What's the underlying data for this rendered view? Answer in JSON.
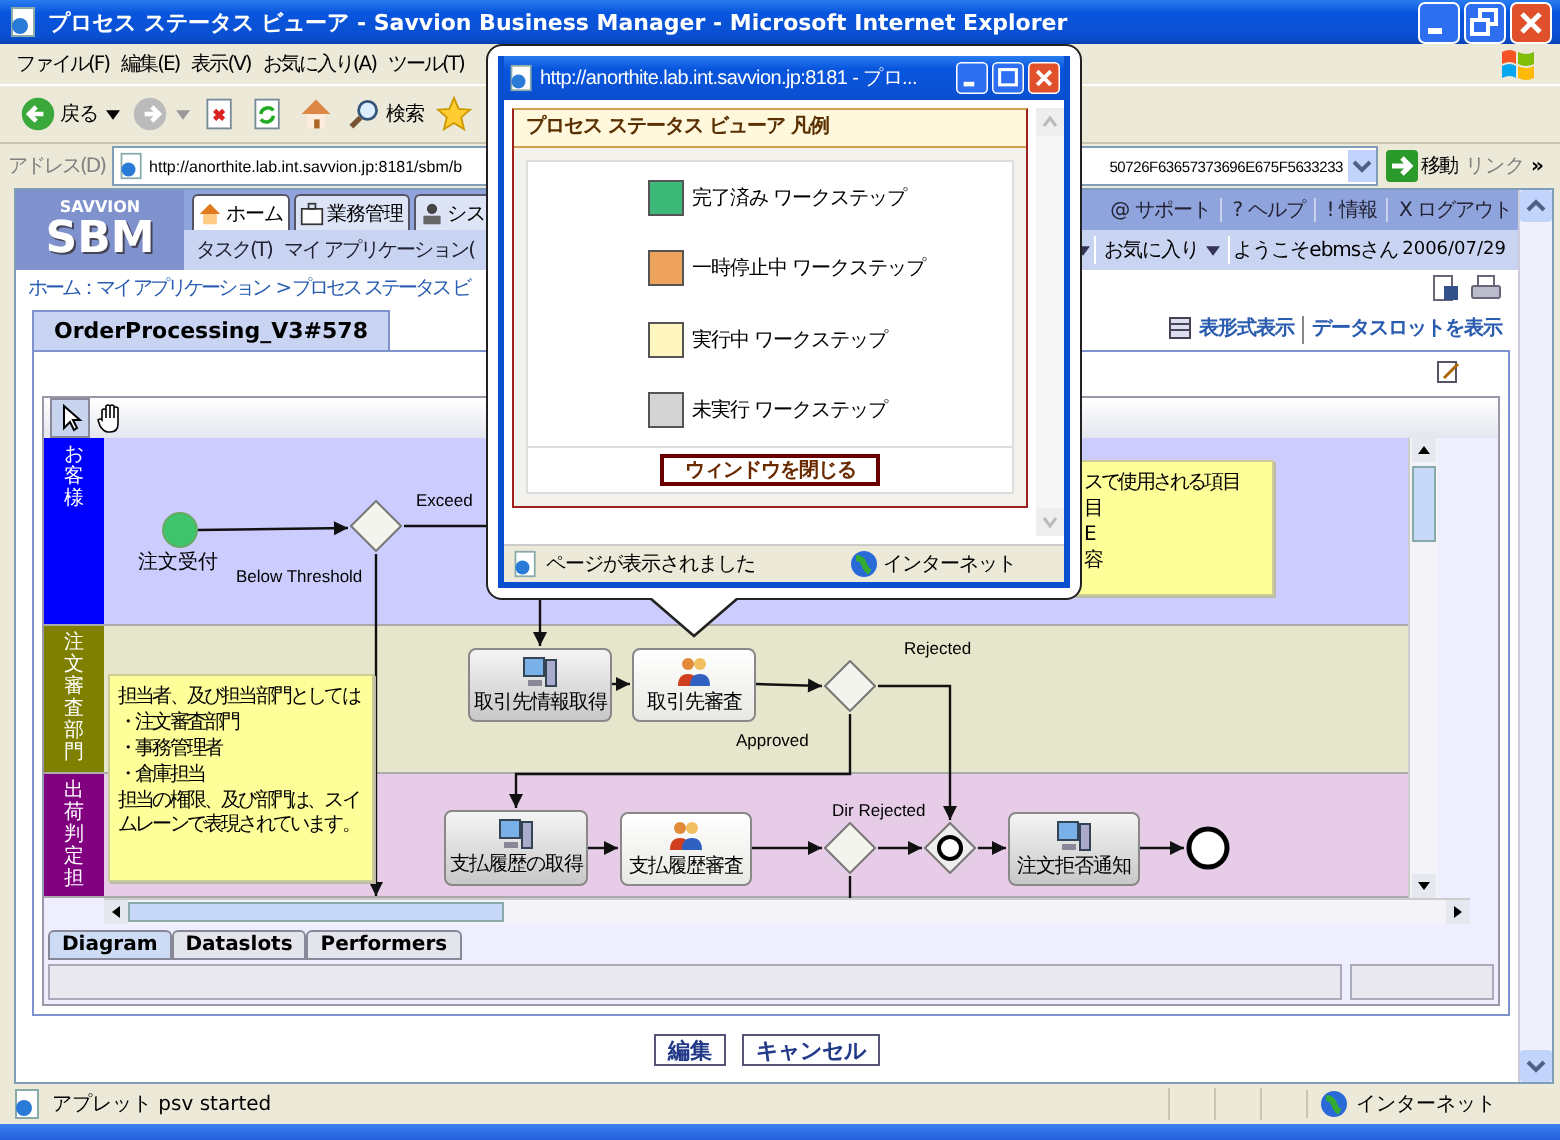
{
  "window": {
    "title": "プロセス ステータス ビューア - Savvion Business Manager - Microsoft Internet Explorer"
  },
  "menu": [
    "ファイル(F)",
    "編集(E)",
    "表示(V)",
    "お気に入り(A)",
    "ツール(T)"
  ],
  "toolbar": {
    "back": "戻る",
    "search": "検索"
  },
  "address_bar": {
    "label": "アドレス(D)",
    "url_start": "http://anorthite.lab.int.savvion.jp:8181/sbm/b",
    "url_end": "50726F63657373696E675F5633233",
    "go": "移動",
    "links": "リンク",
    "more": "»"
  },
  "app_header": {
    "logo_top": "SAVVION",
    "logo": "SBM",
    "tabs": [
      {
        "label": "ホーム",
        "selected": true
      },
      {
        "label": "業務管理",
        "selected": false
      },
      {
        "label": "シス",
        "selected": false
      }
    ],
    "links": [
      "@ サポート",
      "? ヘルプ",
      "! 情報",
      "X ログアウト"
    ],
    "subnav": [
      "タスク(T)",
      "マイ アプリケーション("
    ],
    "favorites": "お気に入り",
    "welcome": "ようこそebmsさん",
    "date": "2006/07/29"
  },
  "breadcrumb": {
    "home": "ホーム：マイ アプリケーション",
    "current": "> プロセス ステータス ビ"
  },
  "process_tab": "OrderProcessing_V3#578",
  "view_links": [
    "表形式表示",
    "データスロットを表示"
  ],
  "diagram": {
    "lanes": [
      {
        "label": "お客様",
        "color": "#0000ff"
      },
      {
        "label": "注文審査部門",
        "color": "#808000"
      },
      {
        "label": "出荷判定担",
        "color": "#800080"
      }
    ],
    "nodes": [
      {
        "kind": "start",
        "label": "注文受付"
      },
      {
        "kind": "gateway"
      },
      {
        "kind": "system",
        "label": "取引先情報取得"
      },
      {
        "kind": "user",
        "label": "取引先審査"
      },
      {
        "kind": "gateway"
      },
      {
        "kind": "system",
        "label": "支払履歴の取得"
      },
      {
        "kind": "user",
        "label": "支払履歴審査"
      },
      {
        "kind": "gateway"
      },
      {
        "kind": "intermediate"
      },
      {
        "kind": "system",
        "label": "注文拒否通知"
      },
      {
        "kind": "end"
      }
    ],
    "flow_labels": [
      "Exceed",
      "Below Threshold",
      "Rejected",
      "Approved",
      "Dir Rejected"
    ],
    "notes": [
      {
        "lines": [
          "担当者、及び担当部門としては",
          "・注文審査部門",
          "・事務管理者",
          "・倉庫担当",
          "担当の権限、及び部門は、スイムレーンで表現されています。"
        ]
      },
      {
        "lines": [
          "スで使用される項目",
          "目",
          "E",
          "容"
        ]
      }
    ]
  },
  "bottom_tabs": [
    {
      "label": "Diagram",
      "selected": true
    },
    {
      "label": "Dataslots",
      "selected": false
    },
    {
      "label": "Performers",
      "selected": false
    }
  ],
  "buttons": [
    "編集",
    "キャンセル"
  ],
  "status_bar": {
    "text": "アプレット psv started",
    "zone": "インターネット"
  },
  "popup": {
    "title": "http://anorthite.lab.int.savvion.jp:8181 - プロ...",
    "heading": "プロセス ステータス ビューア 凡例",
    "legend": [
      {
        "label": "完了済み ワークステップ",
        "color": "#3cb878"
      },
      {
        "label": "一時停止中 ワークステップ",
        "color": "#eea35c"
      },
      {
        "label": "実行中 ワークステップ",
        "color": "#fff6c0"
      },
      {
        "label": "未実行 ワークステップ",
        "color": "#d4d4d4"
      }
    ],
    "close_button": "ウィンドウを閉じる",
    "status": "ページが表示されました",
    "zone": "インターネット"
  }
}
